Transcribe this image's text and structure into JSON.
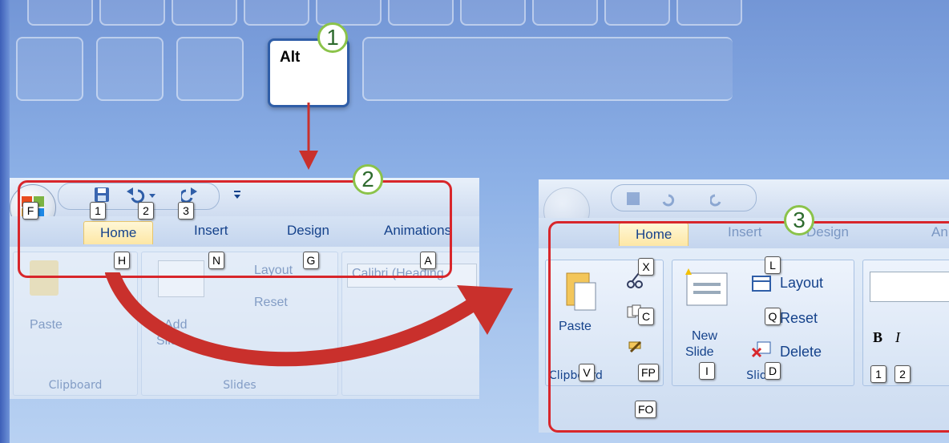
{
  "keyboard": {
    "alt_label": "Alt"
  },
  "steps": [
    "1",
    "2",
    "3"
  ],
  "left_panel": {
    "tabs": [
      "Home",
      "Insert",
      "Design",
      "Animations"
    ],
    "qat_keytips": [
      "1",
      "2",
      "3"
    ],
    "office_keytip": "F",
    "tab_keytips": [
      "H",
      "N",
      "G",
      "A"
    ],
    "ribbon": {
      "paste": "Paste",
      "add_slide_1": "Add",
      "add_slide_2": "Slide",
      "layout": "Layout",
      "reset": "Reset",
      "font": "Calibri (Heading",
      "clipboard": "Clipboard",
      "slides": "Slides"
    }
  },
  "right_panel": {
    "tabs": [
      "Home",
      "Insert",
      "Design",
      "An"
    ],
    "paste": "Paste",
    "new_slide_1": "New",
    "new_slide_2": "Slide",
    "layout": "Layout",
    "reset": "Reset",
    "delete": "Delete",
    "clipboard": "Clipboard",
    "slides": "Slides",
    "bold": "B",
    "italic": "I",
    "keytips": {
      "paste": "V",
      "cut": "X",
      "copy": "C",
      "format_painter": "FP",
      "dialog": "FO",
      "new_slide": "I",
      "layout": "L",
      "reset": "Q",
      "delete": "D",
      "font1": "1",
      "font2": "2"
    }
  },
  "colors": {
    "highlight": "#d8262b",
    "arrow": "#c9302c",
    "accent": "#8bc34a"
  }
}
